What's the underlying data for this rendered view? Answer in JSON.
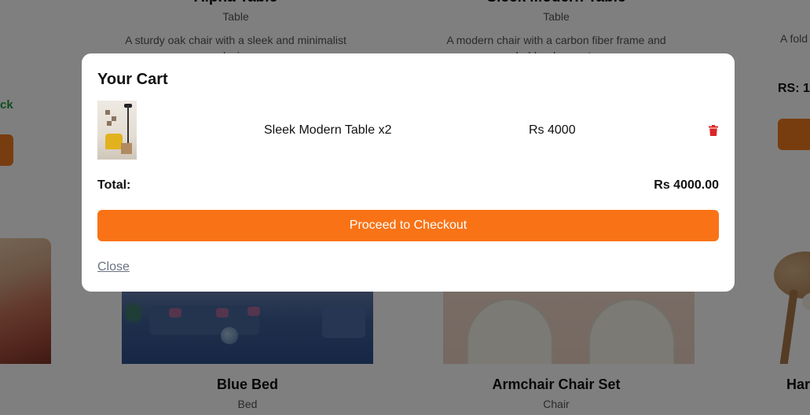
{
  "background": {
    "top_cards": [
      {
        "name": "Alpha Table",
        "category": "Table",
        "description": "A sturdy oak chair with a sleek and minimalist design"
      },
      {
        "name": "Sleek Modern Table",
        "category": "Table",
        "description": "A modern chair with a carbon fiber frame and bold red accents"
      }
    ],
    "left_partial_stock": "ck",
    "right_partial_description": "A fold",
    "right_partial_price": "RS: 1",
    "bottom_cards": [
      {
        "name": "Blue Bed",
        "category": "Bed"
      },
      {
        "name": "Armchair Chair Set",
        "category": "Chair"
      }
    ],
    "right_partial_name": "Har"
  },
  "cart": {
    "title": "Your Cart",
    "items": [
      {
        "name": "Sleek Modern Table x2",
        "price": "Rs 4000"
      }
    ],
    "total_label": "Total:",
    "total_value": "Rs 4000.00",
    "checkout_label": "Proceed to Checkout",
    "close_label": "Close"
  },
  "colors": {
    "accent": "#f97316",
    "delete": "#dc2626",
    "in_stock": "#1f9a3e"
  },
  "icons": {
    "delete": "trash-icon"
  }
}
